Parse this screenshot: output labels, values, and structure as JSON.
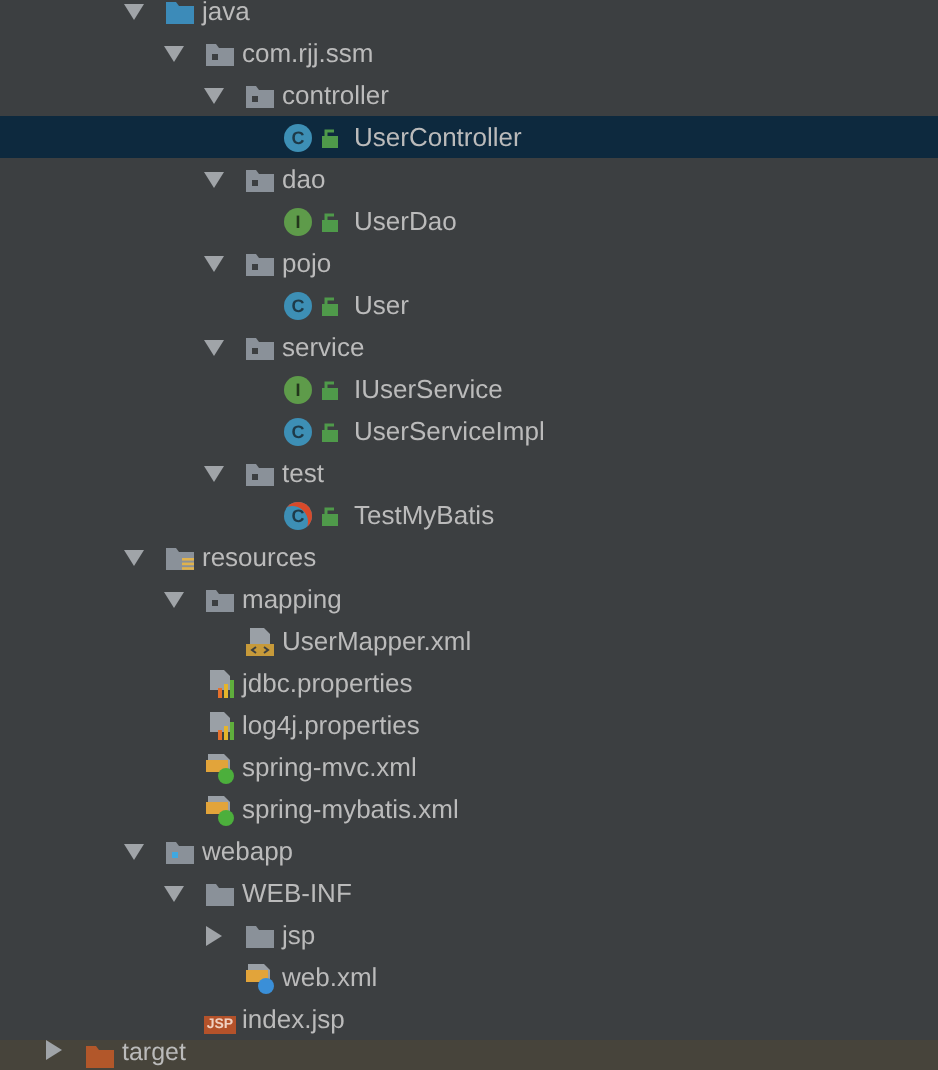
{
  "tree": [
    {
      "children": [
        {
          "children": [
            {
              "label": "java",
              "kind": "source-root",
              "expanded": true,
              "selected": false,
              "children": [
                {
                  "label": "com.rjj.ssm",
                  "kind": "package",
                  "expanded": true,
                  "selected": false,
                  "children": [
                    {
                      "label": "controller",
                      "kind": "package",
                      "expanded": true,
                      "selected": false,
                      "children": [
                        {
                          "label": "UserController",
                          "kind": "class",
                          "icon_letter": "C",
                          "selected": true
                        }
                      ]
                    },
                    {
                      "label": "dao",
                      "kind": "package",
                      "expanded": true,
                      "selected": false,
                      "children": [
                        {
                          "label": "UserDao",
                          "kind": "interface",
                          "icon_letter": "I",
                          "selected": false
                        }
                      ]
                    },
                    {
                      "label": "pojo",
                      "kind": "package",
                      "expanded": true,
                      "selected": false,
                      "children": [
                        {
                          "label": "User",
                          "kind": "class",
                          "icon_letter": "C",
                          "selected": false
                        }
                      ]
                    },
                    {
                      "label": "service",
                      "kind": "package",
                      "expanded": true,
                      "selected": false,
                      "children": [
                        {
                          "label": "IUserService",
                          "kind": "interface",
                          "icon_letter": "I",
                          "selected": false
                        },
                        {
                          "label": "UserServiceImpl",
                          "kind": "class",
                          "icon_letter": "C",
                          "selected": false
                        }
                      ]
                    },
                    {
                      "label": "test",
                      "kind": "package",
                      "expanded": true,
                      "selected": false,
                      "children": [
                        {
                          "label": "TestMyBatis",
                          "kind": "test-class",
                          "icon_letter": "C",
                          "selected": false
                        }
                      ]
                    }
                  ]
                }
              ]
            },
            {
              "label": "resources",
              "kind": "resource-root",
              "expanded": true,
              "selected": false,
              "children": [
                {
                  "label": "mapping",
                  "kind": "package",
                  "expanded": true,
                  "selected": false,
                  "children": [
                    {
                      "label": "UserMapper.xml",
                      "kind": "xml",
                      "selected": false
                    }
                  ]
                },
                {
                  "label": "jdbc.properties",
                  "kind": "properties",
                  "selected": false
                },
                {
                  "label": "log4j.properties",
                  "kind": "properties",
                  "selected": false
                },
                {
                  "label": "spring-mvc.xml",
                  "kind": "spring-xml",
                  "selected": false
                },
                {
                  "label": "spring-mybatis.xml",
                  "kind": "spring-xml",
                  "selected": false
                }
              ]
            },
            {
              "label": "webapp",
              "kind": "web-root",
              "expanded": true,
              "selected": false,
              "children": [
                {
                  "label": "WEB-INF",
                  "kind": "folder",
                  "expanded": true,
                  "selected": false,
                  "children": [
                    {
                      "label": "jsp",
                      "kind": "folder",
                      "expanded": false,
                      "selected": false
                    },
                    {
                      "label": "web.xml",
                      "kind": "web-xml",
                      "selected": false
                    }
                  ]
                },
                {
                  "label": "index.jsp",
                  "kind": "jsp",
                  "icon_letter": "JSP",
                  "selected": false
                }
              ]
            }
          ]
        }
      ]
    },
    {
      "label": "target",
      "kind": "excluded-folder",
      "expanded": false,
      "selected": false
    }
  ]
}
